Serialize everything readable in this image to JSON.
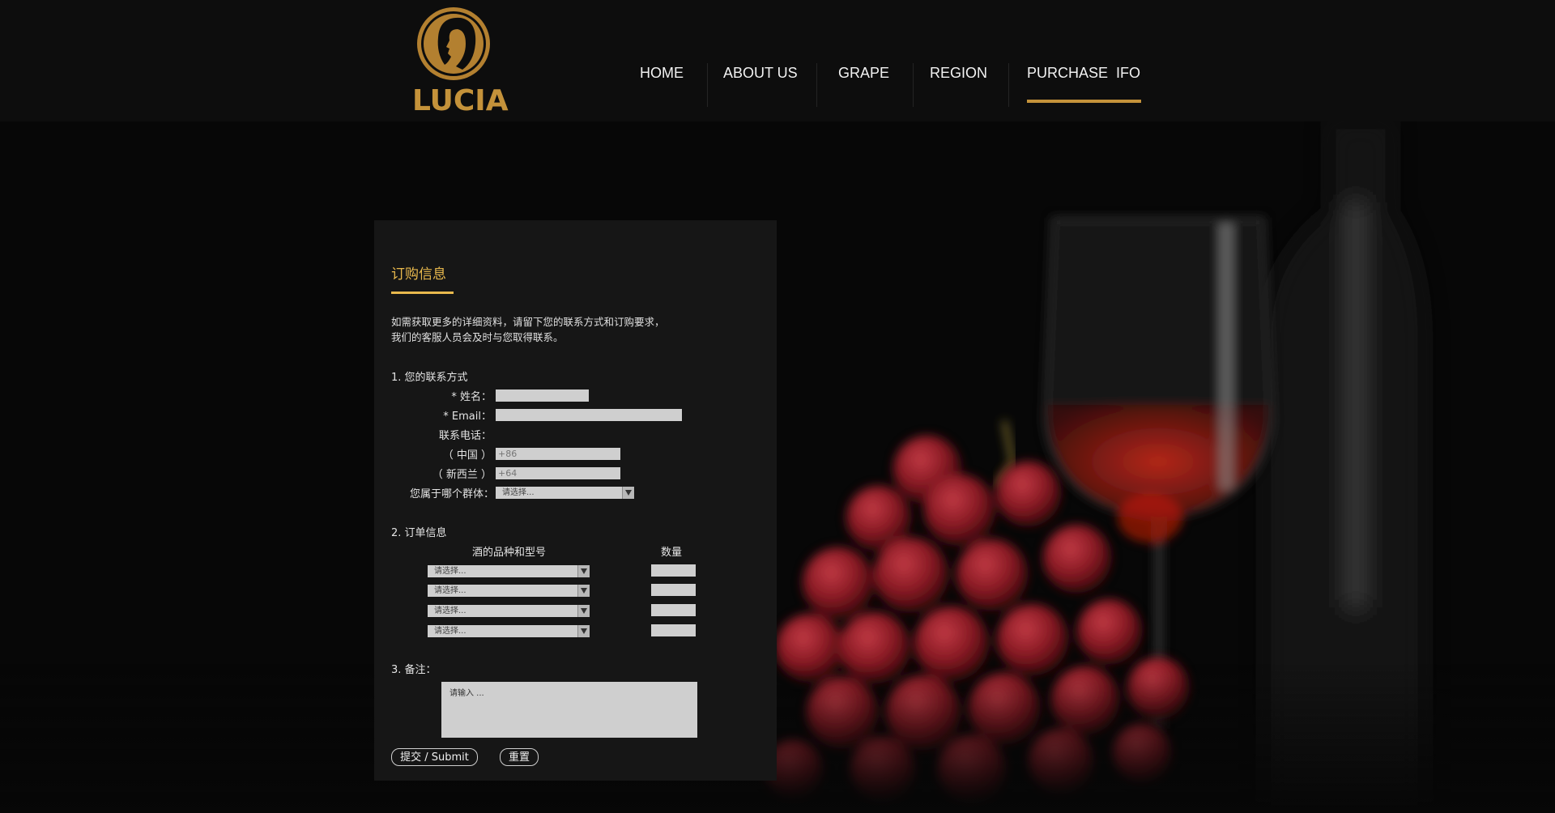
{
  "brand": {
    "name": "LUCIA",
    "accent": "#c4923a"
  },
  "nav": {
    "items": [
      {
        "label": "HOME"
      },
      {
        "label": "ABOUT US"
      },
      {
        "label": "GRAPE"
      },
      {
        "label": "REGION"
      },
      {
        "label": "PURCHASE  IFO",
        "active": true
      }
    ]
  },
  "form": {
    "title": "订购信息",
    "intro_line1": "如需获取更多的详细资料，请留下您的联系方式和订购要求，",
    "intro_line2": "我们的客服人员会及时与您取得联系。",
    "section1": "1. 您的联系方式",
    "name_label": "* 姓名：",
    "email_label": "* Email：",
    "phone_label": "联系电话：",
    "china_label": "（ 中国 ）",
    "china_placeholder": "+86",
    "nz_label": "（ 新西兰 ）",
    "nz_placeholder": "+64",
    "group_label": "您属于哪个群体：",
    "group_value": "请选择...",
    "section2": "2. 订单信息",
    "col_wine": "酒的品种和型号",
    "col_qty": "数量",
    "wine_rows": [
      {
        "value": "请选择..."
      },
      {
        "value": "请选择..."
      },
      {
        "value": "请选择..."
      },
      {
        "value": "请选择..."
      }
    ],
    "section3": "3. 备注：",
    "remark_placeholder": "请输入 ...",
    "submit_label": "提交 / Submit",
    "reset_label": "重置"
  },
  "colors": {
    "title": "#e9b94d",
    "panel": "#161616",
    "field": "#cfcfcf"
  }
}
